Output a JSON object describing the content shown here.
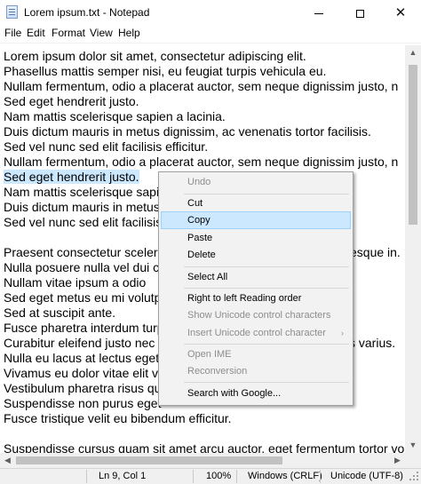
{
  "window": {
    "title": "Lorem ipsum.txt - Notepad",
    "minimize_glyph": "",
    "close_glyph": "✕"
  },
  "menu": [
    "File",
    "Edit",
    "Format",
    "View",
    "Help"
  ],
  "editor": {
    "lines": [
      "Lorem ipsum dolor sit amet, consectetur adipiscing elit.",
      "Phasellus mattis semper nisi, eu feugiat turpis vehicula eu.",
      "Nullam fermentum, odio a placerat auctor, sem neque dignissim justo, n",
      "Sed eget hendrerit justo.",
      "Nam mattis scelerisque sapien a lacinia.",
      "Duis dictum mauris in metus dignissim, ac venenatis tortor facilisis.",
      "Sed vel nunc sed elit facilisis efficitur.",
      "Nullam fermentum, odio a placerat auctor, sem neque dignissim justo, n",
      "Sed eget hendrerit justo.",
      "Nam mattis scelerisque sapie",
      "Duis dictum mauris in metus",
      "Sed vel nunc sed elit facilisis",
      "",
      "Praesent consectetur sceleris",
      "Nulla posuere nulla vel dui c",
      "Nullam vitae ipsum a odio",
      "Sed eget metus eu mi volutp",
      "Sed at suscipit ante.",
      "Fusce pharetra interdum turp",
      "Curabitur eleifend justo nec",
      "Nulla eu lacus at lectus eget",
      "Vivamus eu dolor vitae elit v",
      "Vestibulum pharetra risus qu",
      "Suspendisse non purus eget",
      "Fusce tristique velit eu bibendum efficitur.",
      "",
      "Suspendisse cursus quam sit amet arcu auctor, eget fermentum tortor vo"
    ],
    "right_fragments": {
      "line13": "esque in.",
      "line19": "s varius."
    }
  },
  "context_menu": {
    "items": [
      {
        "label": "Undo",
        "disabled": true
      },
      {
        "label": "Cut",
        "disabled": false
      },
      {
        "label": "Copy",
        "disabled": false,
        "highlighted": true
      },
      {
        "label": "Paste",
        "disabled": false
      },
      {
        "label": "Delete",
        "disabled": false
      },
      {
        "label": "Select All",
        "disabled": false
      },
      {
        "label": "Right to left Reading order",
        "disabled": false
      },
      {
        "label": "Show Unicode control characters",
        "disabled": true
      },
      {
        "label": "Insert Unicode control character",
        "disabled": true,
        "submenu": true
      },
      {
        "label": "Open IME",
        "disabled": true
      },
      {
        "label": "Reconversion",
        "disabled": true
      },
      {
        "label": "Search with Google...",
        "disabled": false
      }
    ],
    "submenu_arrow": "›"
  },
  "status": {
    "position": "Ln 9, Col 1",
    "zoom": "100%",
    "line_endings": "Windows (CRLF)",
    "encoding": "Unicode (UTF-8)"
  },
  "scroll": {
    "up": "▲",
    "down": "▼",
    "left": "◀",
    "right": "▶"
  },
  "colors": {
    "selection": "#cce8ff",
    "menu_highlight": "#cce8ff",
    "disabled_text": "#8d8d8d"
  }
}
